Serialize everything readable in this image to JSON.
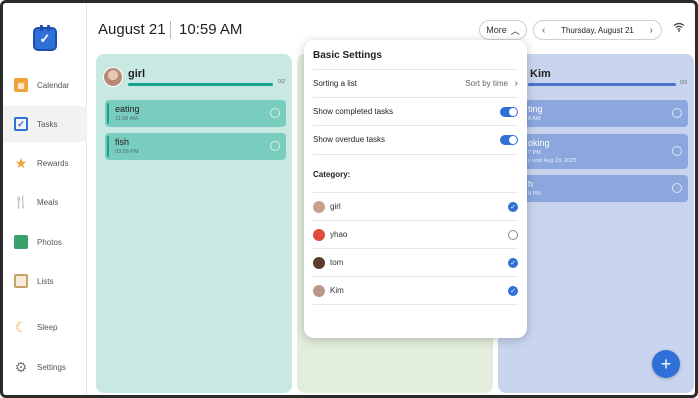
{
  "header": {
    "date": "August 21",
    "time": "10:59 AM",
    "more_label": "More",
    "nav_date": "Thursday, August 21"
  },
  "sidebar": {
    "items": [
      {
        "label": "Calendar",
        "icon": "calendar-icon"
      },
      {
        "label": "Tasks",
        "icon": "tasks-icon",
        "active": true
      },
      {
        "label": "Rewards",
        "icon": "star-icon"
      },
      {
        "label": "Meals",
        "icon": "utensils-icon"
      },
      {
        "label": "Photos",
        "icon": "photo-icon"
      },
      {
        "label": "Lists",
        "icon": "list-icon"
      },
      {
        "label": "Sleep",
        "icon": "moon-icon"
      },
      {
        "label": "Settings",
        "icon": "gear-icon"
      }
    ]
  },
  "columns": {
    "girl": {
      "name": "girl",
      "count": "0/2",
      "color": "#c8e8e2",
      "progress_color": "#18a290",
      "tasks": [
        {
          "name": "eating",
          "time": "11:58 AM"
        },
        {
          "name": "fish",
          "time": "03:58 PM"
        }
      ]
    },
    "kim": {
      "name": "Kim",
      "count": "0/3",
      "color": "#c9d5ee",
      "progress_color": "#4c74c9",
      "tasks": [
        {
          "name": "ting",
          "time": "8 AM",
          "note": ""
        },
        {
          "name": "oking",
          "time": "7 PM",
          "note": "y until Aug 23, 2025"
        },
        {
          "name": "h",
          "time": "8 PM",
          "note": ""
        }
      ]
    }
  },
  "settings": {
    "title": "Basic Settings",
    "sort_label": "Sorting a list",
    "sort_value": "Sort by time",
    "show_completed": "Show completed tasks",
    "show_overdue": "Show overdue tasks",
    "category_label": "Category:",
    "categories": [
      {
        "name": "girl",
        "checked": true,
        "color": "#c9a08e"
      },
      {
        "name": "yhao",
        "checked": false,
        "color": "#e24a3b"
      },
      {
        "name": "tom",
        "checked": true,
        "color": "#5a3b2e"
      },
      {
        "name": "Kim",
        "checked": true,
        "color": "#b89888"
      }
    ]
  },
  "colors": {
    "accent": "#2f6fd8"
  }
}
